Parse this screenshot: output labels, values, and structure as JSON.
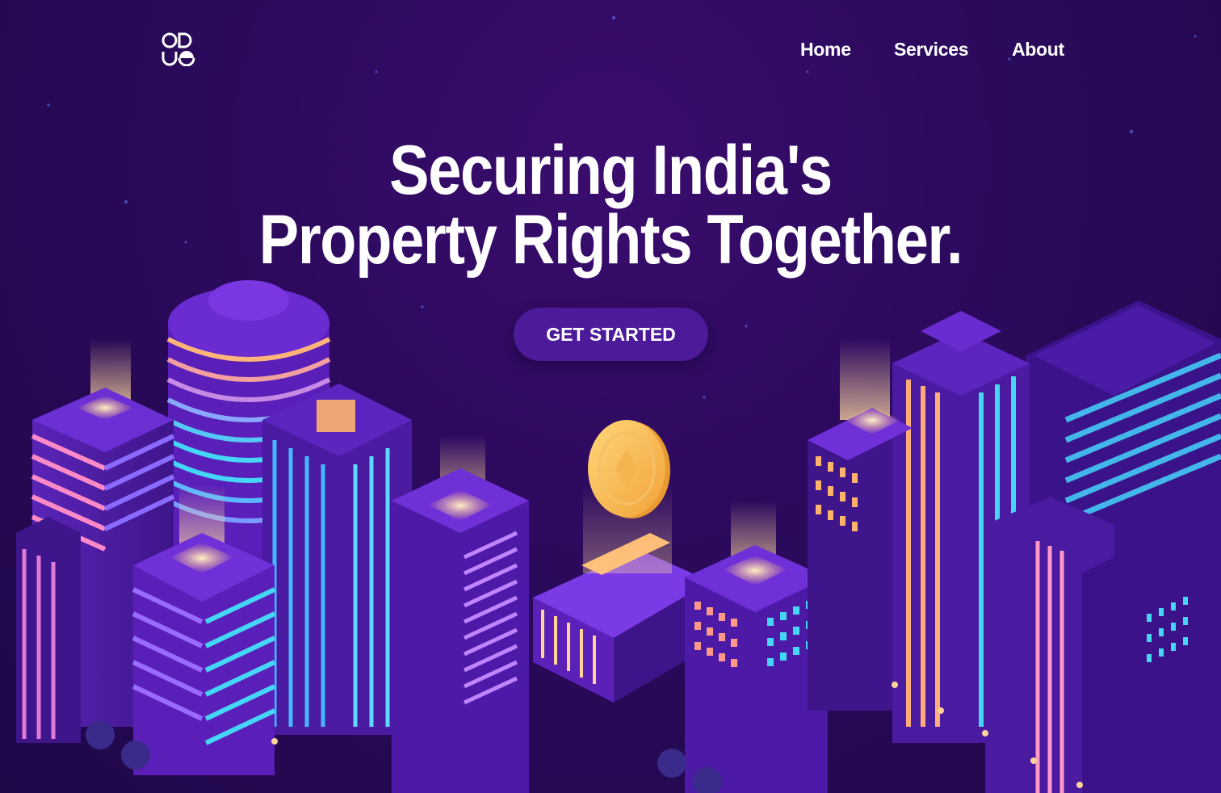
{
  "nav": {
    "logo_icon": "brand-logo-icon",
    "links": [
      {
        "label": "Home"
      },
      {
        "label": "Services"
      },
      {
        "label": "About"
      }
    ]
  },
  "hero": {
    "title_line1": "Securing India's",
    "title_line2": "Property Rights Together.",
    "cta_label": "GET STARTED"
  },
  "illustration": {
    "description_icon": "isometric-city-illustration",
    "coin_icon": "gold-coin-icon",
    "bank_icon": "bank-building-icon"
  },
  "colors": {
    "background": "#2a0b5a",
    "button": "#4d1a9a",
    "neon_orange": "#ffb46b",
    "neon_cyan": "#38d6f0",
    "neon_pink": "#d862ff",
    "text": "#ffffff"
  }
}
